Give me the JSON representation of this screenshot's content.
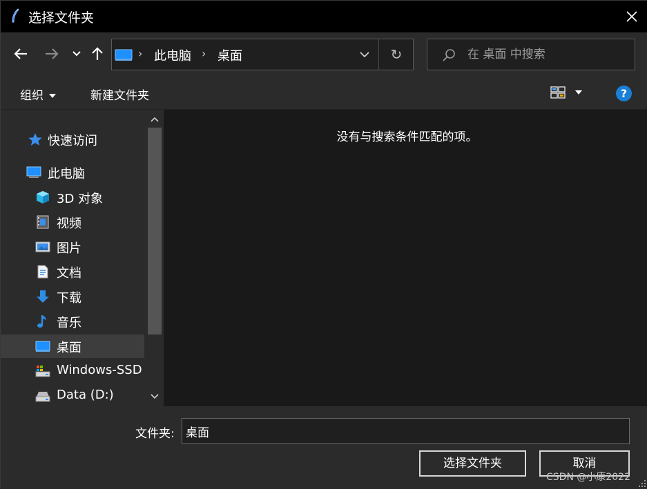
{
  "window": {
    "title": "选择文件夹"
  },
  "nav": {
    "breadcrumbs": [
      "此电脑",
      "桌面"
    ],
    "search_placeholder": "在 桌面 中搜索"
  },
  "toolbar": {
    "organize_label": "组织",
    "new_folder_label": "新建文件夹"
  },
  "sidebar": {
    "items": [
      {
        "label": "快速访问",
        "icon": "star-icon"
      },
      {
        "label": "此电脑",
        "icon": "computer-icon"
      },
      {
        "label": "3D 对象",
        "icon": "cube-icon"
      },
      {
        "label": "视频",
        "icon": "film-icon"
      },
      {
        "label": "图片",
        "icon": "picture-icon"
      },
      {
        "label": "文档",
        "icon": "document-icon"
      },
      {
        "label": "下载",
        "icon": "download-arrow-icon"
      },
      {
        "label": "音乐",
        "icon": "music-note-icon"
      },
      {
        "label": "桌面",
        "icon": "desktop-icon",
        "selected": true
      },
      {
        "label": "Windows-SSD",
        "icon": "drive-icon"
      },
      {
        "label": "Data (D:)",
        "icon": "drive-icon"
      }
    ]
  },
  "main": {
    "empty_message": "没有与搜索条件匹配的项。"
  },
  "footer": {
    "folder_label": "文件夹:",
    "folder_value": "桌面",
    "select_button": "选择文件夹",
    "cancel_button": "取消"
  },
  "watermark": "CSDN @小康2022",
  "colors": {
    "accent": "#1a7fd6",
    "background": "#191919",
    "panel": "#2b2b2b",
    "titlebar": "#000000"
  }
}
